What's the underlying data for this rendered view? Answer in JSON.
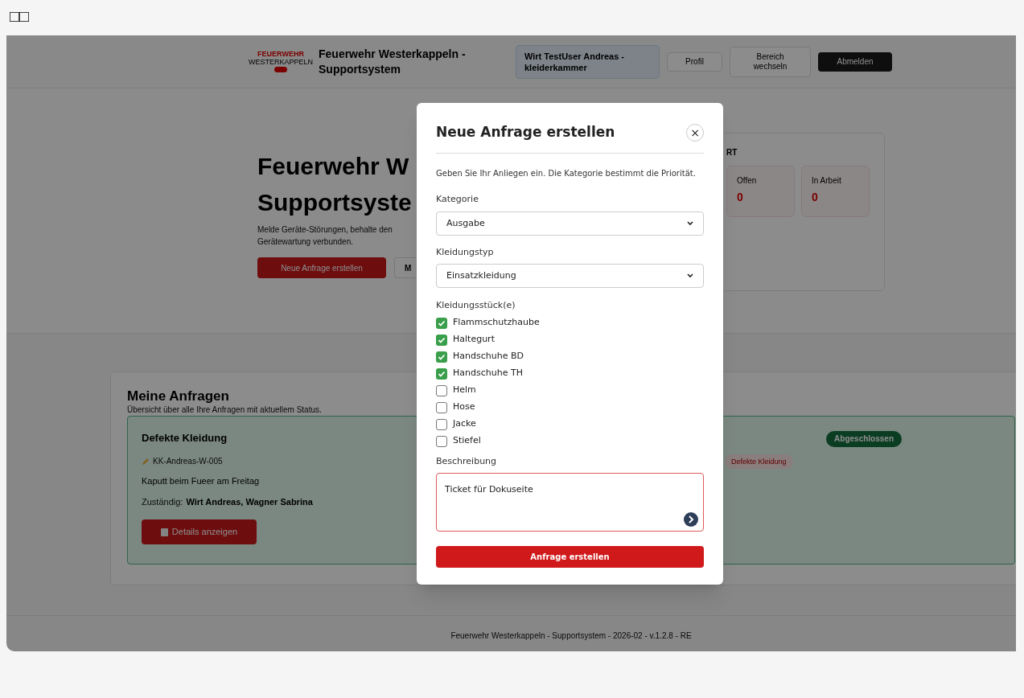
{
  "top_marker": "□□",
  "header": {
    "logo_top": "FEUERWEHR",
    "logo_bottom": "WESTERKAPPELN",
    "title": "Feuerwehr Westerkappeln - Supportsystem",
    "user": "Wirt TestUser Andreas - kleiderkammer",
    "buttons": [
      {
        "label": "Profil",
        "kind": "outline"
      },
      {
        "label": "Bereich wechseln",
        "kind": "outline"
      },
      {
        "label": "Abmelden",
        "kind": "dark"
      }
    ]
  },
  "hero": {
    "title_lines": [
      "Feuerwehr W",
      "Supportsyste"
    ],
    "text_lines": [
      "Melde Geräte-Störungen, behalte den",
      "Gerätewartung verbunden."
    ],
    "buttons": [
      {
        "label": "Neue Anfrage erstellen",
        "kind": "primary"
      },
      {
        "label": "M",
        "kind": "outline"
      }
    ]
  },
  "stats": {
    "heading": "RT",
    "tiles": [
      {
        "label": "Offen",
        "value": "0"
      },
      {
        "label": "In Arbeit",
        "value": "0"
      }
    ]
  },
  "requests": {
    "title": "Meine Anfragen",
    "subtitle": "Übersicht über alle Ihre Anfragen mit aktuellem Status.",
    "items": [
      {
        "title": "Defekte Kleidung",
        "status": "Abgeschlossen",
        "id": "KK-Andreas-W-005",
        "tag": "Defekte Kleidung",
        "description": "Kaputt beim Fueer am Freitag",
        "assignee_label": "Zuständig:",
        "assignee": "Wirt Andreas, Wagner Sabrina",
        "button": "Details anzeigen"
      }
    ]
  },
  "footer": "Feuerwehr Westerkappeln - Supportsystem - 2026-02 - v.1.2.8 - RE",
  "modal": {
    "title": "Neue Anfrage erstellen",
    "close": "×",
    "intro": "Geben Sie Ihr Anliegen ein. Die Kategorie bestimmt die Priorität.",
    "category": {
      "label": "Kategorie",
      "value": "Ausgabe"
    },
    "type": {
      "label": "Kleidungstyp",
      "value": "Einsatzkleidung"
    },
    "items_label": "Kleidungsstück(e)",
    "items": [
      {
        "label": "Flammschutzhaube",
        "checked": true
      },
      {
        "label": "Haltegurt",
        "checked": true
      },
      {
        "label": "Handschuhe BD",
        "checked": true
      },
      {
        "label": "Handschuhe TH",
        "checked": true
      },
      {
        "label": "Helm",
        "checked": false
      },
      {
        "label": "Hose",
        "checked": false
      },
      {
        "label": "Jacke",
        "checked": false
      },
      {
        "label": "Stiefel",
        "checked": false
      }
    ],
    "description": {
      "label": "Beschreibung",
      "value": "Ticket für Dokuseite"
    },
    "submit": "Anfrage erstellen"
  }
}
